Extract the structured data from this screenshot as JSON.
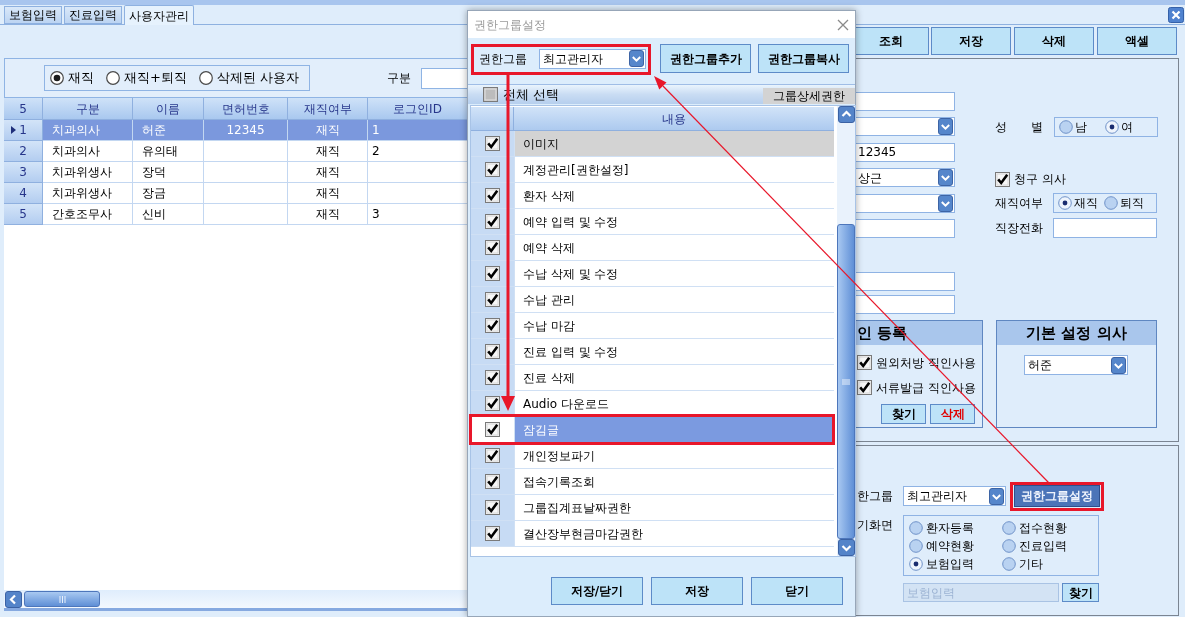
{
  "tabs": [
    {
      "label": "보험입력",
      "selected": false
    },
    {
      "label": "진료입력",
      "selected": false
    },
    {
      "label": "사용자관리",
      "selected": true
    }
  ],
  "user_filter": {
    "status_options": [
      {
        "label": "재직",
        "selected": true
      },
      {
        "label": "재직+퇴직",
        "selected": false
      },
      {
        "label": "삭제된 사용자",
        "selected": false
      }
    ],
    "category_label": "구분"
  },
  "user_table": {
    "row_count": "5",
    "columns": [
      "구분",
      "이름",
      "면허번호",
      "재직여부",
      "로그인ID"
    ],
    "rows": [
      {
        "number": "1",
        "selected": true,
        "category": "치과의사",
        "name": "허준",
        "license_no": "12345",
        "status": "재직",
        "login_id": "1"
      },
      {
        "number": "2",
        "selected": false,
        "category": "치과의사",
        "name": "유의태",
        "status": "재직",
        "login_id": "2"
      },
      {
        "number": "3",
        "selected": false,
        "category": "치과위생사",
        "name": "장덕",
        "status": "재직"
      },
      {
        "number": "4",
        "selected": false,
        "category": "치과위생사",
        "name": "장금",
        "status": "재직"
      },
      {
        "number": "5",
        "selected": false,
        "category": "간호조무사",
        "name": "신비",
        "status": "재직",
        "login_id": "3"
      }
    ]
  },
  "toolbar_buttons": [
    "조회",
    "저장",
    "삭제",
    "액셀"
  ],
  "user_form": {
    "fields": [
      {
        "kind": "input"
      },
      {
        "kind": "dropdown"
      },
      {
        "kind": "input",
        "value": "12345"
      },
      {
        "kind": "dropdown",
        "value": "상근"
      },
      {
        "kind": "dropdown"
      },
      {
        "kind": "input"
      }
    ],
    "more_fields": [
      {
        "kind": "input"
      },
      {
        "kind": "input"
      }
    ],
    "gender": {
      "label": "성 별",
      "options": [
        {
          "label": "남",
          "selected": false
        },
        {
          "label": "여",
          "selected": true
        }
      ]
    },
    "claim_doctor": {
      "label": "청구 의사",
      "checked": true
    },
    "employment": {
      "label": "재직여부",
      "options": [
        {
          "label": "재직",
          "selected": true
        },
        {
          "label": "퇴직",
          "selected": false
        }
      ]
    },
    "work_phone": {
      "label": "직장전화"
    }
  },
  "seal_group": {
    "title": "인 등록",
    "options": [
      {
        "label": "원외처방 직인사용",
        "checked": true
      },
      {
        "label": "서류발급 직인사용",
        "checked": true
      }
    ],
    "buttons": [
      {
        "label": "찾기",
        "kind": "normal"
      },
      {
        "label": "삭제",
        "kind": "danger"
      }
    ]
  },
  "default_doctor": {
    "title": "기본 설정 의사",
    "value": "허준"
  },
  "permission_section": {
    "group_label": "한그룹",
    "group_value": "최고관리자",
    "settings_button": {
      "label": "권한그룹설정",
      "focused": true
    },
    "start_screen_label": "기화면",
    "start_screen_options": [
      {
        "label": "환자등록",
        "selected": false
      },
      {
        "label": "접수현황",
        "selected": false
      },
      {
        "label": "예약현황",
        "selected": false
      },
      {
        "label": "진료입력",
        "selected": false
      },
      {
        "label": "보험입력",
        "selected": true
      },
      {
        "label": "기타",
        "selected": false
      }
    ],
    "start_screen_field": {
      "value": "보험입력",
      "disabled": true
    },
    "find_button": "찾기"
  },
  "dialog": {
    "title": "권한그룹설정",
    "group_label": "권한그룹",
    "group_value": "최고관리자",
    "top_buttons": [
      "권한그룹추가",
      "권한그룹복사"
    ],
    "select_all": {
      "label": "전체 선택",
      "checked": false
    },
    "detail_label": "그룹상세권한",
    "content_column": "내용",
    "permissions": [
      {
        "label": "이미지",
        "checked": true,
        "selected": false,
        "focused": true
      },
      {
        "label": "계정관리[권한설정]",
        "checked": true,
        "selected": false,
        "focused": false
      },
      {
        "label": "환자 삭제",
        "checked": true,
        "selected": false,
        "focused": false
      },
      {
        "label": "예약 입력 및 수정",
        "checked": true,
        "selected": false,
        "focused": false
      },
      {
        "label": "예약 삭제",
        "checked": true,
        "selected": false,
        "focused": false
      },
      {
        "label": "수납 삭제 및 수정",
        "checked": true,
        "selected": false,
        "focused": false
      },
      {
        "label": "수납 관리",
        "checked": true,
        "selected": false,
        "focused": false
      },
      {
        "label": "수납 마감",
        "checked": true,
        "selected": false,
        "focused": false
      },
      {
        "label": "진료 입력 및 수정",
        "checked": true,
        "selected": false,
        "focused": false
      },
      {
        "label": "진료 삭제",
        "checked": true,
        "selected": false,
        "focused": false
      },
      {
        "label": "Audio 다운로드",
        "checked": true,
        "selected": false,
        "focused": false
      },
      {
        "label": "잠김글",
        "checked": true,
        "selected": true,
        "focused": false
      },
      {
        "label": "개인정보파기",
        "checked": true,
        "selected": false,
        "focused": false
      },
      {
        "label": "접속기록조회",
        "checked": true,
        "selected": false,
        "focused": false
      },
      {
        "label": "그룹집계표날짜권한",
        "checked": true,
        "selected": false,
        "focused": false
      },
      {
        "label": "결산장부현금마감권한",
        "checked": true,
        "selected": false,
        "focused": false
      }
    ],
    "bottom_buttons": [
      "저장/닫기",
      "저장",
      "닫기"
    ]
  }
}
